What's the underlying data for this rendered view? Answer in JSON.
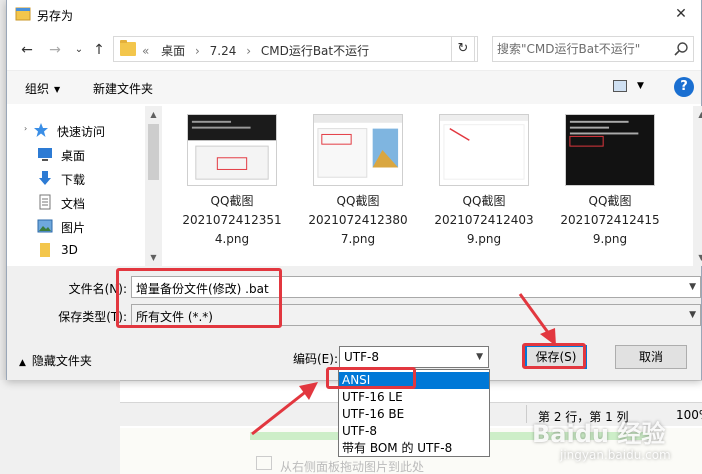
{
  "window": {
    "title": "另存为",
    "close_glyph": "✕"
  },
  "nav": {
    "back_glyph": "←",
    "forward_glyph": "→",
    "recent_glyph": "⌄",
    "up_glyph": "↑",
    "refresh_glyph": "↻",
    "crumb_prefix": "«",
    "crumbs": [
      "桌面",
      "7.24",
      "CMD运行Bat不运行"
    ],
    "crumb_sep": "›",
    "search_placeholder": "搜索\"CMD运行Bat不运行\""
  },
  "toolbar": {
    "organize": "组织",
    "new_folder": "新建文件夹",
    "help": "?"
  },
  "navpane": {
    "items": [
      {
        "label": "快速访问",
        "icon": "star-icon",
        "pinned": false
      },
      {
        "label": "桌面",
        "icon": "desktop-icon",
        "pinned": true
      },
      {
        "label": "下载",
        "icon": "download-icon",
        "pinned": true
      },
      {
        "label": "文档",
        "icon": "document-icon",
        "pinned": true
      },
      {
        "label": "图片",
        "icon": "picture-icon",
        "pinned": true
      },
      {
        "label": "3D",
        "icon": "folder-icon",
        "pinned": false
      }
    ],
    "pin_glyph": "📌"
  },
  "files": [
    {
      "line1": "QQ截图",
      "line2": "2021072412351",
      "line3": "4.png"
    },
    {
      "line1": "QQ截图",
      "line2": "2021072412380",
      "line3": "7.png"
    },
    {
      "line1": "QQ截图",
      "line2": "2021072412403",
      "line3": "9.png"
    },
    {
      "line1": "QQ截图",
      "line2": "2021072412415",
      "line3": "9.png"
    }
  ],
  "form": {
    "filename_label": "文件名(N):",
    "filename_value": "增量备份文件(修改) .bat",
    "filetype_label": "保存类型(T):",
    "filetype_value": "所有文件 (*.*)"
  },
  "bottom": {
    "hide_folders": "隐藏文件夹",
    "encoding_label": "编码(E):",
    "encoding_value": "UTF-8",
    "save": "保存(S)",
    "cancel": "取消"
  },
  "encoding_options": [
    "ANSI",
    "UTF-16 LE",
    "UTF-16 BE",
    "UTF-8",
    "带有 BOM 的 UTF-8"
  ],
  "background_app": {
    "status_position": "第 2 行，第 1 列",
    "status_zoom": "100%",
    "hint": "从右侧面板拖动图片到此处"
  },
  "watermark": {
    "main": "Baidu 经验",
    "sub": "jingyan.baidu.com"
  },
  "colors": {
    "accent": "#0078d7",
    "annotation": "#e2373f"
  }
}
